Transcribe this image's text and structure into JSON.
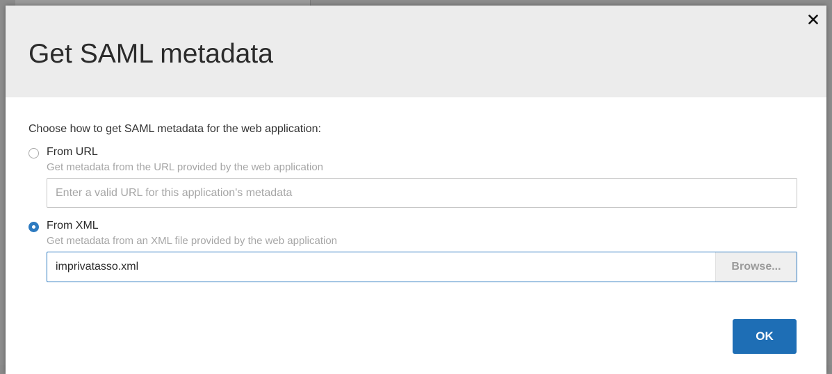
{
  "dialog": {
    "title": "Get SAML metadata",
    "close_icon": "close-icon"
  },
  "instruction": "Choose how to get SAML metadata for the web application:",
  "options": [
    {
      "label": "From URL",
      "help": "Get metadata from the URL provided by the web application",
      "selected": false,
      "input": {
        "placeholder": "Enter a valid URL for this application's metadata",
        "value": ""
      }
    },
    {
      "label": "From XML",
      "help": "Get metadata from an XML file provided by the web application",
      "selected": true,
      "file": {
        "name": "imprivatasso.xml",
        "browse_label": "Browse..."
      }
    }
  ],
  "footer": {
    "ok_label": "OK"
  },
  "colors": {
    "accent": "#1e6eb5",
    "header_bg": "#ececec",
    "help_text": "#a6a6a6"
  }
}
